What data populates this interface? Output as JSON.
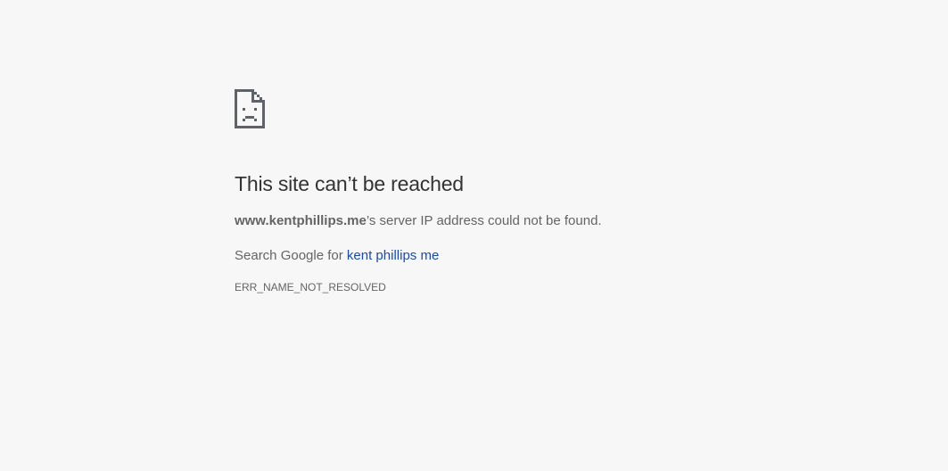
{
  "error": {
    "title": "This site can’t be reached",
    "host": "www.kentphillips.me",
    "message_suffix": "’s server IP address could not be found.",
    "search_prefix": "Search Google for ",
    "search_link_text": "kent phillips me",
    "code": "ERR_NAME_NOT_RESOLVED",
    "icon": "sad-page-icon"
  },
  "colors": {
    "background": "#f7f7f7",
    "title": "#333333",
    "text": "#646464",
    "link": "#1a4bb1"
  }
}
